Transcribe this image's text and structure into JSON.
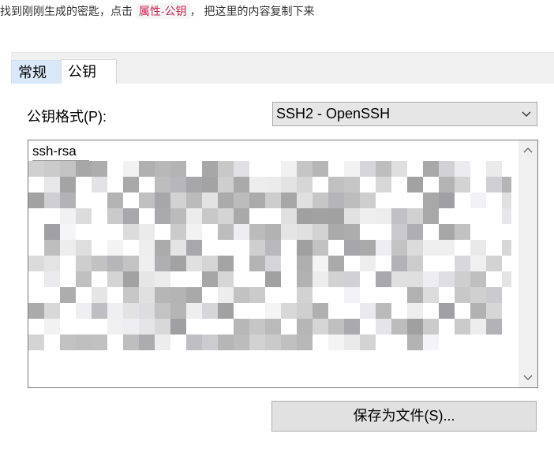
{
  "instruction": {
    "before": "找到刚刚生成的密匙，点击 ",
    "code_tag": "属性-公钥",
    "after": "， 把这里的内容复制下来"
  },
  "tabs": [
    {
      "label": "常规",
      "selected": false
    },
    {
      "label": "公钥",
      "selected": true
    }
  ],
  "format": {
    "label": "公钥格式(P):",
    "selected_value": "SSH2 - OpenSSH"
  },
  "key_box": {
    "visible_text": "ssh-rsa"
  },
  "save_button": {
    "label": "保存为文件(S)..."
  },
  "colors": {
    "code_tag_text": "#c7254e",
    "tab_selected_bg": "#ffffff",
    "tab_unselected_bg": "#d9e9f9",
    "button_bg": "#e1e1e1"
  }
}
